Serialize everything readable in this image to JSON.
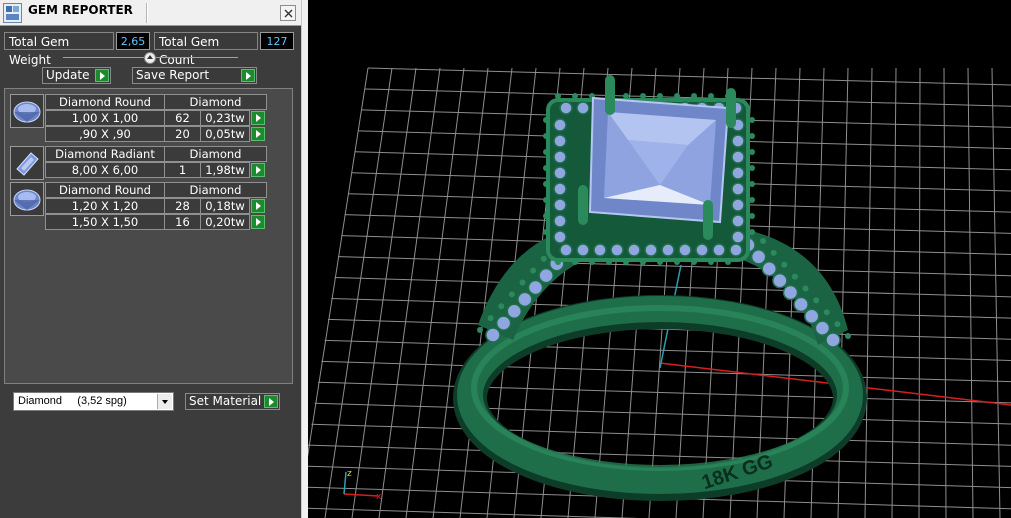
{
  "window": {
    "title": "GEM REPORTER"
  },
  "summary": {
    "total_weight_label": "Total Gem Weight",
    "total_weight_value": "2,65",
    "total_count_label": "Total Gem Count",
    "total_count_value": "127"
  },
  "toolbar": {
    "update_label": "Update",
    "save_report_label": "Save Report"
  },
  "gem_groups": [
    {
      "icon": "round-gem-icon",
      "name": "Diamond Round",
      "material": "Diamond",
      "rows": [
        {
          "size": "1,00 X 1,00",
          "count": "62",
          "weight": "0,23tw"
        },
        {
          "size": ",90 X ,90",
          "count": "20",
          "weight": "0,05tw"
        }
      ]
    },
    {
      "icon": "radiant-gem-icon",
      "name": "Diamond Radiant",
      "material": "Diamond",
      "rows": [
        {
          "size": "8,00 X 6,00",
          "count": "1",
          "weight": "1,98tw"
        }
      ]
    },
    {
      "icon": "round-gem-icon",
      "name": "Diamond Round",
      "material": "Diamond",
      "rows": [
        {
          "size": "1,20 X 1,20",
          "count": "28",
          "weight": "0,18tw"
        },
        {
          "size": "1,50 X 1,50",
          "count": "16",
          "weight": "0,20tw"
        }
      ]
    }
  ],
  "material": {
    "selected": "Diamond     (3,52 spg)",
    "set_label": "Set Material"
  },
  "viewport": {
    "engraving": "18K GG",
    "axis_gizmo": {
      "z": "z",
      "x": "x"
    },
    "colors": {
      "metal": "#1f6e4a",
      "stone": "#8fa6e0",
      "grid": "#9a9a9a",
      "x_axis": "#d42020",
      "z_axis": "#2aa0b0"
    }
  }
}
